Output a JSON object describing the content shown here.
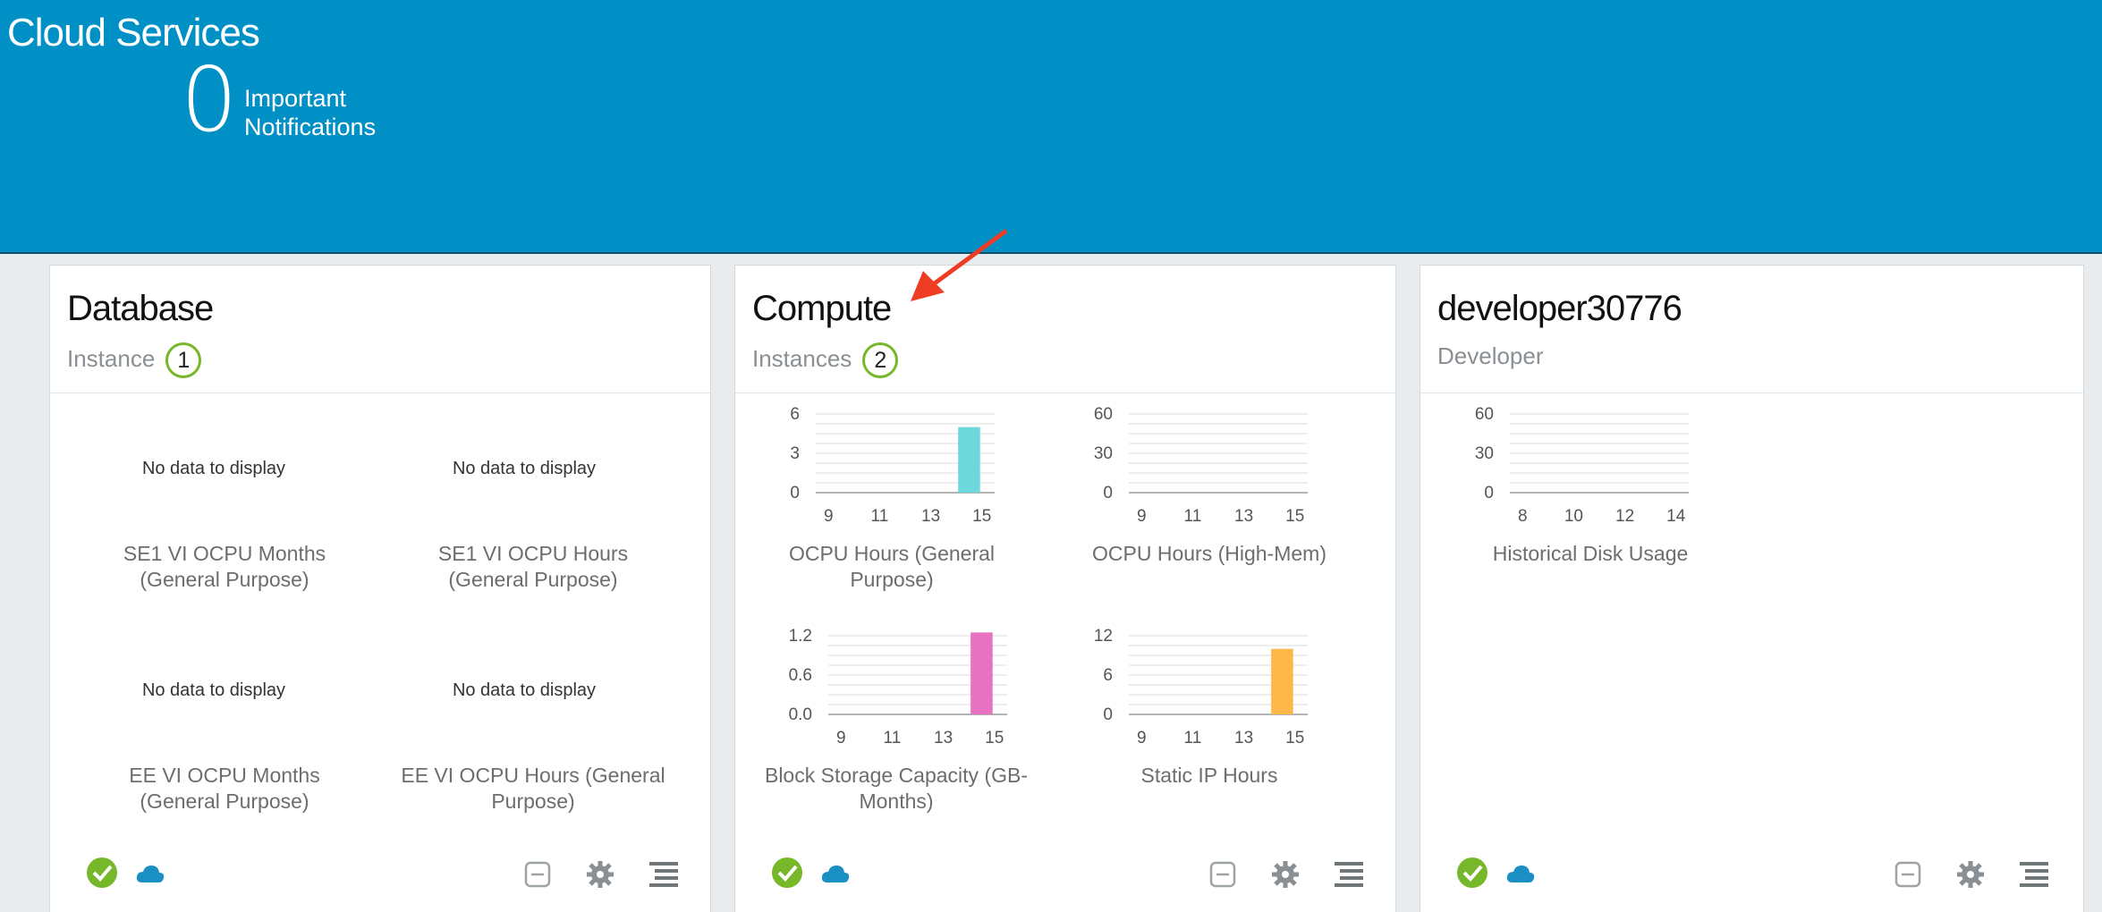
{
  "header": {
    "app_title": "Cloud Services",
    "notification_count": "0",
    "notification_label": "Important Notifications"
  },
  "cards": [
    {
      "title": "Database",
      "subtitle": "Instance",
      "count": "1",
      "no_data": "No data to display",
      "charts": [
        {
          "caption": "SE1 VI OCPU Months (General Purpose)"
        },
        {
          "caption": "SE1 VI OCPU Hours (General Purpose)"
        },
        {
          "caption": "EE VI OCPU Months (General Purpose)"
        },
        {
          "caption": "EE VI OCPU Hours (General Purpose)"
        }
      ]
    },
    {
      "title": "Compute",
      "subtitle": "Instances",
      "count": "2"
    },
    {
      "title": "developer30776",
      "subtitle": "Developer"
    }
  ],
  "chart_data": [
    {
      "type": "bar",
      "title": "OCPU Hours (General Purpose)",
      "x": [
        14,
        15
      ],
      "x_ticks": [
        "9",
        "11",
        "13",
        "15"
      ],
      "y_ticks": [
        "0",
        "3",
        "6"
      ],
      "ylim": [
        0,
        6
      ],
      "values": [
        5
      ],
      "bar_x": [
        14.5
      ],
      "color": "#6dd8dc"
    },
    {
      "type": "bar",
      "title": "OCPU Hours (High-Mem)",
      "x_ticks": [
        "9",
        "11",
        "13",
        "15"
      ],
      "y_ticks": [
        "0",
        "30",
        "60"
      ],
      "ylim": [
        0,
        60
      ],
      "values": []
    },
    {
      "type": "bar",
      "title": "Block Storage Capacity (GB-Months)",
      "x_ticks": [
        "9",
        "11",
        "13",
        "15"
      ],
      "y_ticks": [
        "0.0",
        "0.6",
        "1.2"
      ],
      "ylim": [
        0,
        1.2
      ],
      "values": [
        1.25
      ],
      "bar_x": [
        14.5
      ],
      "color": "#e872c2"
    },
    {
      "type": "bar",
      "title": "Static IP Hours",
      "x_ticks": [
        "9",
        "11",
        "13",
        "15"
      ],
      "y_ticks": [
        "0",
        "6",
        "12"
      ],
      "ylim": [
        0,
        12
      ],
      "values": [
        10
      ],
      "bar_x": [
        14.5
      ],
      "color": "#fdb84a"
    },
    {
      "type": "bar",
      "title": "Historical Disk Usage",
      "x_ticks": [
        "8",
        "10",
        "12",
        "14"
      ],
      "y_ticks": [
        "0",
        "30",
        "60"
      ],
      "ylim": [
        0,
        60
      ],
      "values": []
    }
  ],
  "colors": {
    "banner": "#0190c6",
    "status_ok": "#76b82a",
    "cloud": "#1a8fc4",
    "annotation_arrow": "#ef3d23"
  },
  "icons": [
    "check-circle-icon",
    "cloud-icon",
    "minimize-icon",
    "gear-icon",
    "menu-icon",
    "arrow-annotation"
  ]
}
